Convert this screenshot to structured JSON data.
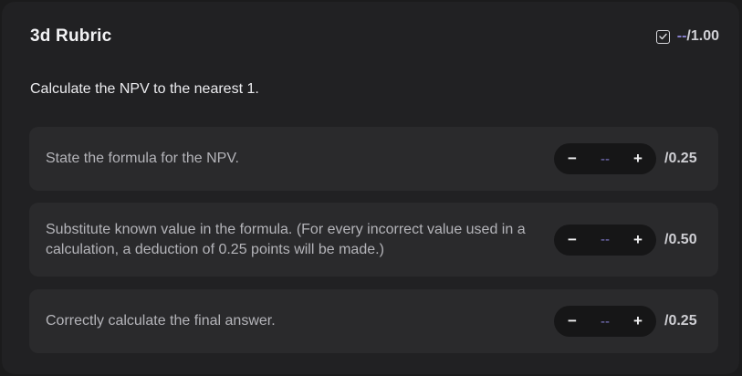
{
  "header": {
    "title": "3d Rubric",
    "score_value": "--",
    "score_max": "/1.00",
    "score_icon": "checkbox-check-icon"
  },
  "description": "Calculate the NPV to the nearest 1.",
  "criteria": [
    {
      "text": "State the formula for the NPV.",
      "value": "--",
      "max": "/0.25",
      "minus": "−",
      "plus": "+"
    },
    {
      "text": "Substitute known value in the formula. (For every incorrect value used in a calculation, a deduction of 0.25 points will be made.)",
      "value": "--",
      "max": "/0.50",
      "minus": "−",
      "plus": "+"
    },
    {
      "text": "Correctly calculate the final answer.",
      "value": "--",
      "max": "/0.25",
      "minus": "−",
      "plus": "+"
    }
  ],
  "colors": {
    "background": "#1b1b1c",
    "panel": "#212123",
    "row": "#2a2a2c",
    "accent": "#8c85d6"
  }
}
